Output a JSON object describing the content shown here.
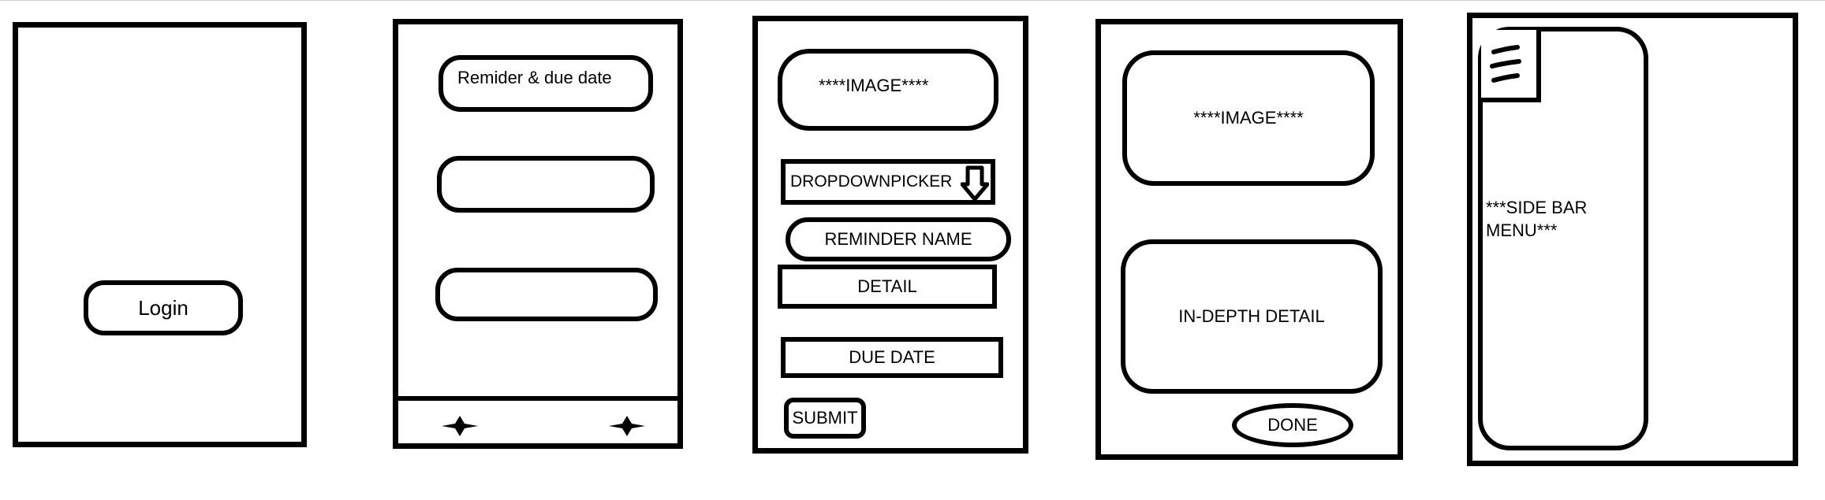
{
  "screens": {
    "login": {
      "login_button": "Login"
    },
    "list": {
      "card_1_label": "Remider & due date"
    },
    "form": {
      "image_label": "****IMAGE****",
      "dropdown_label": "DROPDOWNPICKER",
      "reminder_name": "REMINDER NAME",
      "detail": "DETAIL",
      "due_date": "DUE DATE",
      "submit": "SUBMIT"
    },
    "detail": {
      "image_label": "****IMAGE****",
      "in_depth": "IN-DEPTH DETAIL",
      "done": "DONE"
    },
    "sidebar": {
      "menu_line1": "***SIDE BAR",
      "menu_line2": "MENU***"
    }
  }
}
